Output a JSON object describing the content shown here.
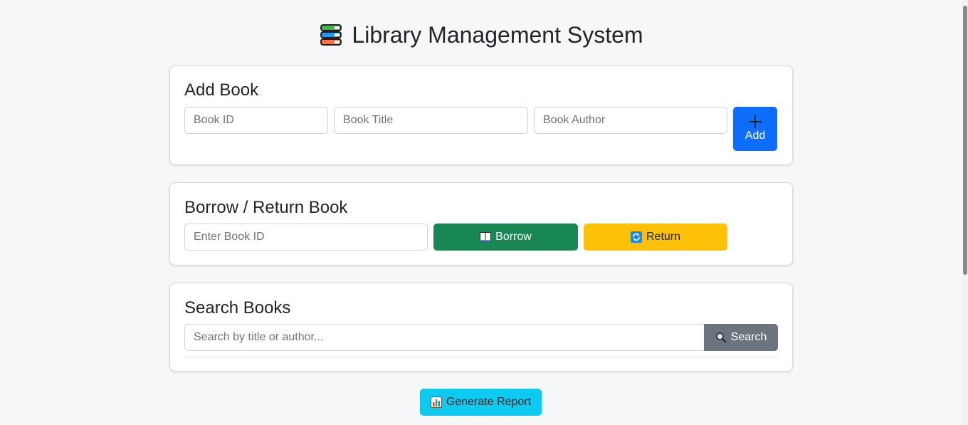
{
  "page": {
    "title": "Library Management System"
  },
  "add_book": {
    "heading": "Add Book",
    "id_placeholder": "Book ID",
    "title_placeholder": "Book Title",
    "author_placeholder": "Book Author",
    "add_label": "Add",
    "add_icon": "plus-icon"
  },
  "borrow_return": {
    "heading": "Borrow / Return Book",
    "id_placeholder": "Enter Book ID",
    "borrow_label": "Borrow",
    "borrow_icon": "open-book-icon",
    "return_label": "Return",
    "return_icon": "arrows-cycle-icon"
  },
  "search": {
    "heading": "Search Books",
    "placeholder": "Search by title or author...",
    "button_label": "Search",
    "button_icon": "magnifier-icon"
  },
  "report": {
    "label": "Generate Report",
    "icon": "bar-chart-icon"
  },
  "colors": {
    "primary": "#0d6efd",
    "success": "#198754",
    "warning": "#ffc107",
    "secondary": "#6c757d",
    "info": "#0dcaf0"
  }
}
